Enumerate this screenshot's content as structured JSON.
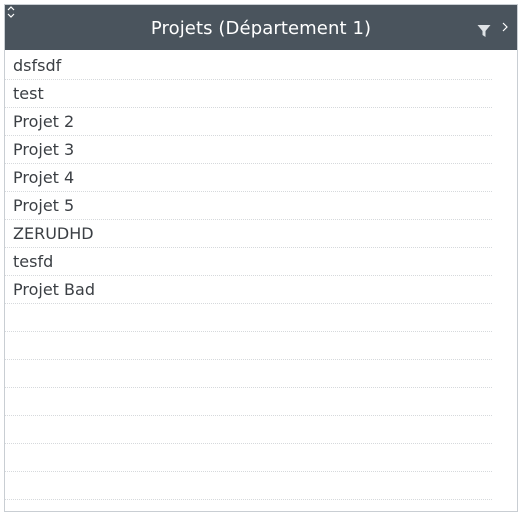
{
  "panel": {
    "title": "Projets (Département 1)",
    "icons": {
      "collapse": "collapse-chevrons-icon",
      "filter": "filter-icon",
      "expand": "chevron-right-icon"
    },
    "colors": {
      "header_bg": "#4a545d",
      "header_text": "#ffffff",
      "row_text": "#3b3f44"
    }
  },
  "projects": [
    {
      "name": "dsfsdf"
    },
    {
      "name": "test"
    },
    {
      "name": "Projet 2"
    },
    {
      "name": "Projet 3"
    },
    {
      "name": "Projet 4"
    },
    {
      "name": "Projet 5"
    },
    {
      "name": "ZERUDHD"
    },
    {
      "name": "tesfd"
    },
    {
      "name": "Projet Bad"
    },
    {
      "name": ""
    },
    {
      "name": ""
    },
    {
      "name": ""
    },
    {
      "name": ""
    },
    {
      "name": ""
    },
    {
      "name": ""
    },
    {
      "name": ""
    }
  ]
}
